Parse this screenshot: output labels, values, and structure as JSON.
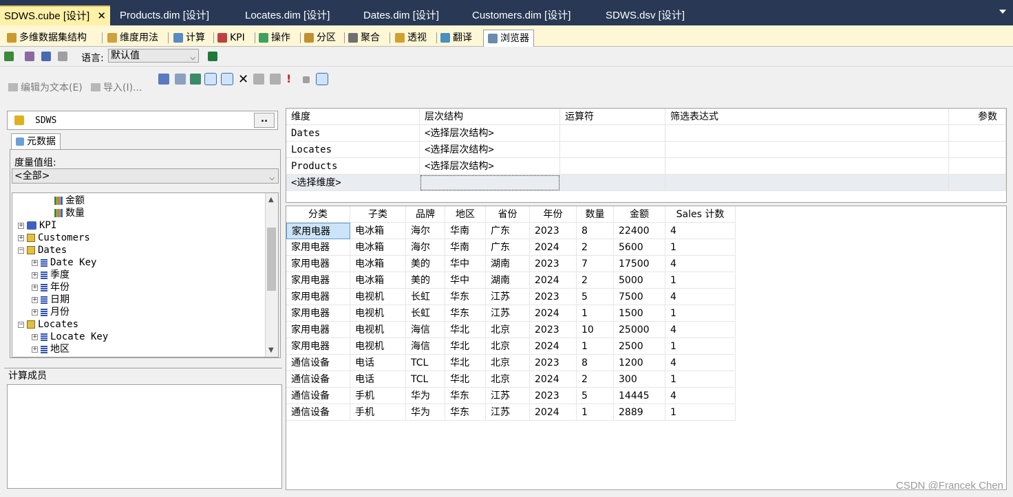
{
  "doc_tabs": [
    {
      "label": "SDWS.cube [设计]",
      "active": true
    },
    {
      "label": "Products.dim [设计]"
    },
    {
      "label": "Locates.dim [设计]"
    },
    {
      "label": "Dates.dim [设计]"
    },
    {
      "label": "Customers.dim [设计]"
    },
    {
      "label": "SDWS.dsv [设计]"
    }
  ],
  "doc_close": "✕",
  "designer_tabs": [
    "多维数据集结构",
    "维度用法",
    "计算",
    "KPI",
    "操作",
    "分区",
    "聚合",
    "透视",
    "翻译",
    "浏览器"
  ],
  "lang_toolbar": {
    "label": "语言:",
    "value": "默认值"
  },
  "browser_toolbar": {
    "edit_as_text": "编辑为文本(E)",
    "import": "导入(I)..."
  },
  "left_panel": {
    "cube_name": "SDWS",
    "more_button": "..",
    "metadata_tab": "元数据",
    "measure_group_label": "度量值组:",
    "measure_group_value": "<全部>",
    "tree": [
      {
        "label": "金额",
        "icon": "measure",
        "indent": 3
      },
      {
        "label": "数量",
        "icon": "measure",
        "indent": 3
      },
      {
        "label": "KPI",
        "icon": "kpi",
        "indent": 1,
        "exp": "+"
      },
      {
        "label": "Customers",
        "icon": "dim",
        "indent": 1,
        "exp": "+"
      },
      {
        "label": "Dates",
        "icon": "dim",
        "indent": 1,
        "exp": "−"
      },
      {
        "label": "Date Key",
        "icon": "attr",
        "indent": 2,
        "exp": "+"
      },
      {
        "label": "季度",
        "icon": "attr",
        "indent": 2,
        "exp": "+"
      },
      {
        "label": "年份",
        "icon": "attr",
        "indent": 2,
        "exp": "+"
      },
      {
        "label": "日期",
        "icon": "attr",
        "indent": 2,
        "exp": "+"
      },
      {
        "label": "月份",
        "icon": "attr",
        "indent": 2,
        "exp": "+"
      },
      {
        "label": "Locates",
        "icon": "dim",
        "indent": 1,
        "exp": "−"
      },
      {
        "label": "Locate Key",
        "icon": "attr",
        "indent": 2,
        "exp": "+"
      },
      {
        "label": "地区",
        "icon": "attr",
        "indent": 2,
        "exp": "+"
      }
    ],
    "calc_members_label": "计算成员"
  },
  "filter": {
    "headers": [
      "维度",
      "层次结构",
      "运算符",
      "筛选表达式",
      "参数"
    ],
    "rows": [
      [
        "Dates",
        "<选择层次结构>",
        "",
        "",
        ""
      ],
      [
        "Locates",
        "<选择层次结构>",
        "",
        "",
        ""
      ],
      [
        "Products",
        "<选择层次结构>",
        "",
        "",
        ""
      ],
      [
        "<选择维度>",
        "",
        "",
        "",
        ""
      ]
    ]
  },
  "data_table": {
    "headers": [
      "分类",
      "子类",
      "品牌",
      "地区",
      "省份",
      "年份",
      "数量",
      "金额",
      "Sales 计数"
    ],
    "rows": [
      [
        "家用电器",
        "电冰箱",
        "海尔",
        "华南",
        "广东",
        "2023",
        "8",
        "22400",
        "4"
      ],
      [
        "家用电器",
        "电冰箱",
        "海尔",
        "华南",
        "广东",
        "2024",
        "2",
        "5600",
        "1"
      ],
      [
        "家用电器",
        "电冰箱",
        "美的",
        "华中",
        "湖南",
        "2023",
        "7",
        "17500",
        "4"
      ],
      [
        "家用电器",
        "电冰箱",
        "美的",
        "华中",
        "湖南",
        "2024",
        "2",
        "5000",
        "1"
      ],
      [
        "家用电器",
        "电视机",
        "长虹",
        "华东",
        "江苏",
        "2023",
        "5",
        "7500",
        "4"
      ],
      [
        "家用电器",
        "电视机",
        "长虹",
        "华东",
        "江苏",
        "2024",
        "1",
        "1500",
        "1"
      ],
      [
        "家用电器",
        "电视机",
        "海信",
        "华北",
        "北京",
        "2023",
        "10",
        "25000",
        "4"
      ],
      [
        "家用电器",
        "电视机",
        "海信",
        "华北",
        "北京",
        "2024",
        "1",
        "2500",
        "1"
      ],
      [
        "通信设备",
        "电话",
        "TCL",
        "华北",
        "北京",
        "2023",
        "8",
        "1200",
        "4"
      ],
      [
        "通信设备",
        "电话",
        "TCL",
        "华北",
        "北京",
        "2024",
        "2",
        "300",
        "1"
      ],
      [
        "通信设备",
        "手机",
        "华为",
        "华东",
        "江苏",
        "2023",
        "5",
        "14445",
        "4"
      ],
      [
        "通信设备",
        "手机",
        "华为",
        "华东",
        "江苏",
        "2024",
        "1",
        "2889",
        "1"
      ]
    ]
  },
  "watermark": "CSDN @Francek Chen"
}
